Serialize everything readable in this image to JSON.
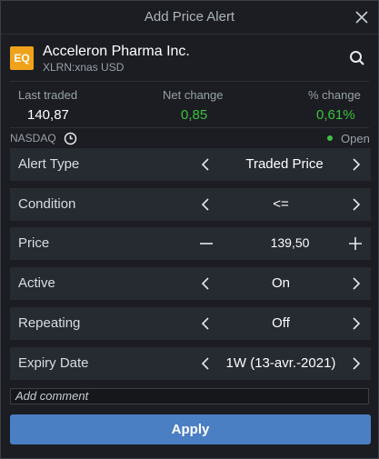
{
  "dialog": {
    "title": "Add Price Alert",
    "close_icon": "close-icon"
  },
  "instrument": {
    "logo_text": "EQ",
    "name": "Acceleron Pharma Inc.",
    "symbol_line": "XLRN:xnas USD",
    "search_icon": "search-icon"
  },
  "stats": {
    "last_traded_label": "Last traded",
    "last_traded_value": "140,87",
    "net_change_label": "Net change",
    "net_change_value": "0,85",
    "pct_change_label": "% change",
    "pct_change_value": "0,61%"
  },
  "market": {
    "exchange": "NASDAQ",
    "status": "Open"
  },
  "rows": {
    "alert_type": {
      "label": "Alert Type",
      "value": "Traded Price"
    },
    "condition": {
      "label": "Condition",
      "value": "<="
    },
    "price": {
      "label": "Price",
      "value": "139,50"
    },
    "active": {
      "label": "Active",
      "value": "On"
    },
    "repeating": {
      "label": "Repeating",
      "value": "Off"
    },
    "expiry": {
      "label": "Expiry Date",
      "value": "1W (13-avr.-2021)"
    }
  },
  "comment": {
    "placeholder": "Add comment"
  },
  "apply_label": "Apply",
  "colors": {
    "positive": "#3fc13f",
    "apply_button": "#4b7fc4",
    "logo": "#f0a21b"
  }
}
